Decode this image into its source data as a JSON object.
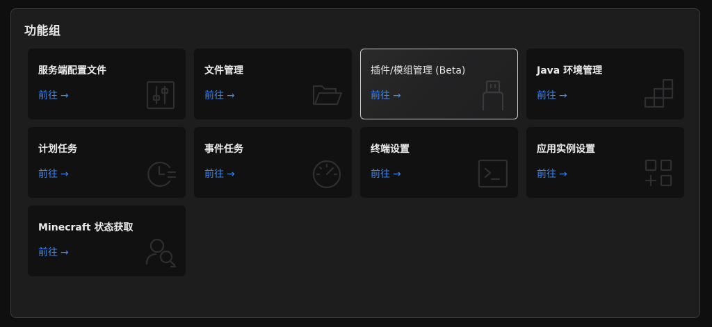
{
  "panel": {
    "title": "功能组"
  },
  "cards": [
    {
      "title": "服务端配置文件",
      "link": "前往",
      "arrow": "→",
      "icon": "sliders-icon"
    },
    {
      "title": "文件管理",
      "link": "前往",
      "arrow": "→",
      "icon": "folder-icon"
    },
    {
      "title": "插件/模组管理 (Beta)",
      "link": "前往",
      "arrow": "→",
      "icon": "usb-plug-icon",
      "active": true
    },
    {
      "title": "Java 环境管理",
      "link": "前往",
      "arrow": "→",
      "icon": "blocks-icon"
    },
    {
      "title": "计划任务",
      "link": "前往",
      "arrow": "→",
      "icon": "schedule-clock-icon"
    },
    {
      "title": "事件任务",
      "link": "前往",
      "arrow": "→",
      "icon": "speedometer-icon"
    },
    {
      "title": "终端设置",
      "link": "前往",
      "arrow": "→",
      "icon": "terminal-icon"
    },
    {
      "title": "应用实例设置",
      "link": "前往",
      "arrow": "→",
      "icon": "app-grid-icon"
    },
    {
      "title": "Minecraft 状态获取",
      "link": "前往",
      "arrow": "→",
      "icon": "user-search-icon"
    }
  ],
  "colors": {
    "link": "#3f86e8",
    "card_background": "#111112",
    "panel_background": "#1d1d1e"
  }
}
